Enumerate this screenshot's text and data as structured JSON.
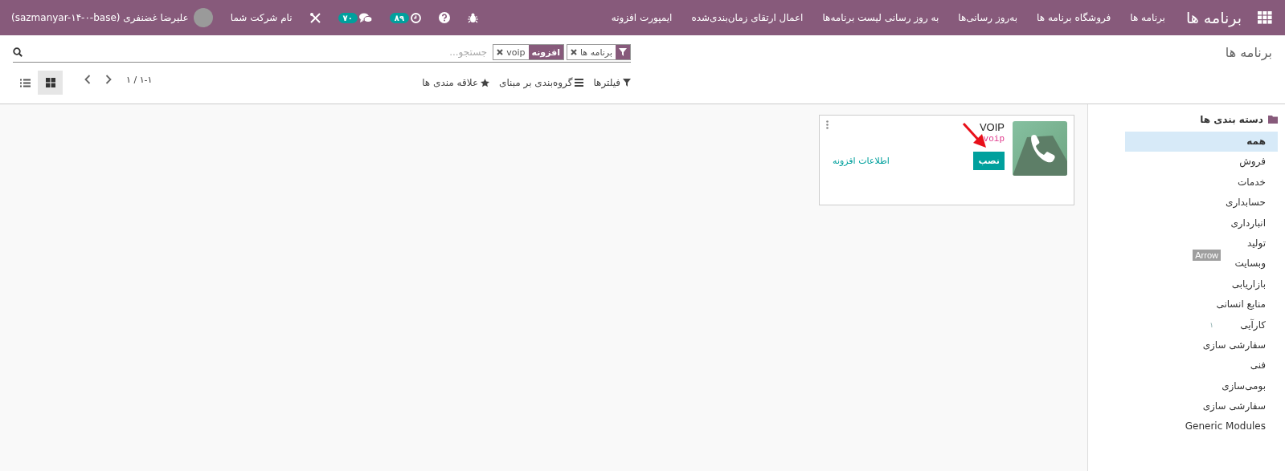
{
  "navbar": {
    "app_title": "برنامه ها",
    "menu": [
      "برنامه ها",
      "فروشگاه برنامه ها",
      "به‌روز رسانی‌ها",
      "به روز رسانی لیست برنامه‌ها",
      "اعمال ارتقای زمان‌بندی‌شده",
      "ایمپورت افزونه"
    ],
    "activity_count": "۸۹",
    "messages_count": "۷۰",
    "company": "نام شرکت شما",
    "user": "علیرضا غضنفری (sazmanyar-۱۴-۰-base)"
  },
  "control_panel": {
    "breadcrumb": "برنامه ها",
    "search": {
      "placeholder": "جستجو...",
      "facets": [
        {
          "kind": "filter",
          "values": [
            "برنامه ها"
          ]
        },
        {
          "kind": "field",
          "label": "افزونه",
          "values": [
            "voip"
          ]
        }
      ]
    },
    "buttons": [
      {
        "kind": "filter",
        "label": "فیلترها"
      },
      {
        "kind": "group",
        "label": "گروه‌بندی بر مبنای"
      },
      {
        "kind": "favorite",
        "label": "علاقه مندی ها"
      }
    ],
    "pager": "۱-۱ / ۱",
    "views": [
      {
        "kind": "kanban",
        "selected": true
      },
      {
        "kind": "list",
        "selected": false
      }
    ]
  },
  "apps": [
    {
      "name": "VOIP",
      "technical_name": "voip",
      "install_label": "نصب",
      "info_link": "اطلاعات افزونه"
    }
  ],
  "sidebar": {
    "title": "دسته بندی ها",
    "items": [
      {
        "label": "همه",
        "selected": true
      },
      {
        "label": "فروش",
        "selected": false
      },
      {
        "label": "خدمات",
        "selected": false
      },
      {
        "label": "حسابداری",
        "selected": false
      },
      {
        "label": "انبارداری",
        "selected": false
      },
      {
        "label": "تولید",
        "selected": false
      },
      {
        "label": "وبسایت",
        "selected": false
      },
      {
        "label": "بازاریابی",
        "selected": false
      },
      {
        "label": "منابع انسانی",
        "selected": false
      },
      {
        "label": "کارآیی",
        "selected": false,
        "count": "۱"
      },
      {
        "label": "سفارشی سازی",
        "selected": false
      },
      {
        "label": "فنی",
        "selected": false
      },
      {
        "label": "بومی‌سازی",
        "selected": false
      },
      {
        "label": "سفارشی سازی",
        "selected": false
      },
      {
        "label": "Generic Modules",
        "selected": false
      }
    ]
  },
  "annotation": {
    "label": "Arrow"
  }
}
